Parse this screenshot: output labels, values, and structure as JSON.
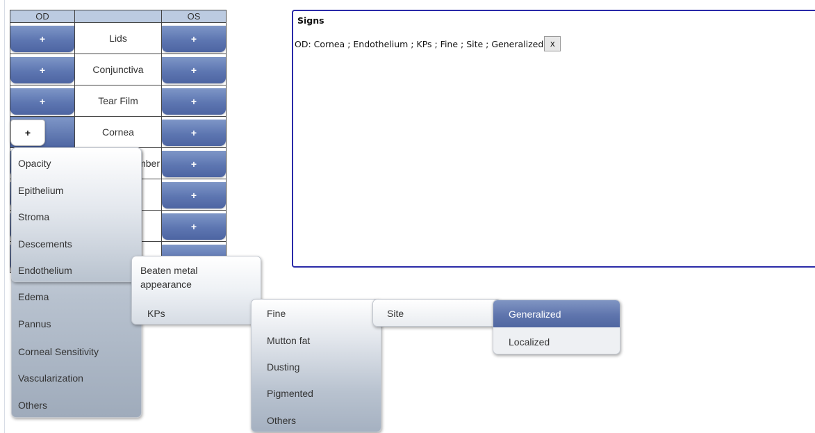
{
  "grid": {
    "header_od": "OD",
    "header_os": "OS",
    "add_label": "+",
    "rows": [
      {
        "label": "Lids"
      },
      {
        "label": "Conjunctiva"
      },
      {
        "label": "Tear Film"
      },
      {
        "label": "Cornea"
      },
      {
        "label": "Anterior Chamber"
      },
      {
        "label": ""
      },
      {
        "label": ""
      },
      {
        "label": ""
      }
    ]
  },
  "signs": {
    "title": "Signs",
    "entry": "OD: Cornea ; Endothelium ; KPs ; Fine ; Site ; Generalized",
    "remove_label": "x"
  },
  "menus": {
    "cornea": [
      "Opacity",
      "Epithelium",
      "Stroma",
      "Descements",
      "Endothelium",
      "Edema",
      "Pannus",
      "Corneal Sensitivity",
      "Vascularization",
      "Others"
    ],
    "endothelium": [
      "Beaten metal appearance",
      "KPs"
    ],
    "kps": [
      "Fine",
      "Mutton fat",
      "Dusting",
      "Pigmented",
      "Others"
    ],
    "fine": [
      "Site"
    ],
    "site": [
      "Generalized",
      "Localized"
    ]
  },
  "colors": {
    "button_blue": "#5d76b1",
    "panel_border": "#2a2aa8",
    "highlight": "#5f75ad"
  }
}
